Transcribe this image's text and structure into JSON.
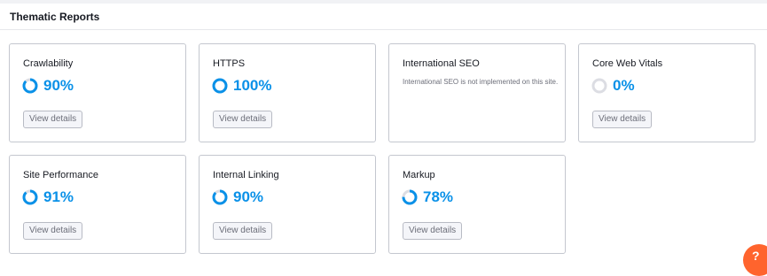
{
  "header": {
    "title": "Thematic Reports"
  },
  "cards": [
    {
      "title": "Crawlability",
      "value": "90%",
      "progress": 0.9,
      "button": "View details"
    },
    {
      "title": "HTTPS",
      "value": "100%",
      "progress": 1.0,
      "button": "View details"
    },
    {
      "title": "International SEO",
      "note": "International SEO is not implemented on this site."
    },
    {
      "title": "Core Web Vitals",
      "value": "0%",
      "progress": 0.0,
      "button": "View details"
    },
    {
      "title": "Site Performance",
      "value": "91%",
      "progress": 0.91,
      "button": "View details"
    },
    {
      "title": "Internal Linking",
      "value": "90%",
      "progress": 0.9,
      "button": "View details"
    },
    {
      "title": "Markup",
      "value": "78%",
      "progress": 0.78,
      "button": "View details"
    }
  ],
  "colors": {
    "accent": "#0a91e8",
    "ring_track": "#dcdde3",
    "help_badge": "#ff642d"
  },
  "help_badge": {
    "label": "?"
  }
}
